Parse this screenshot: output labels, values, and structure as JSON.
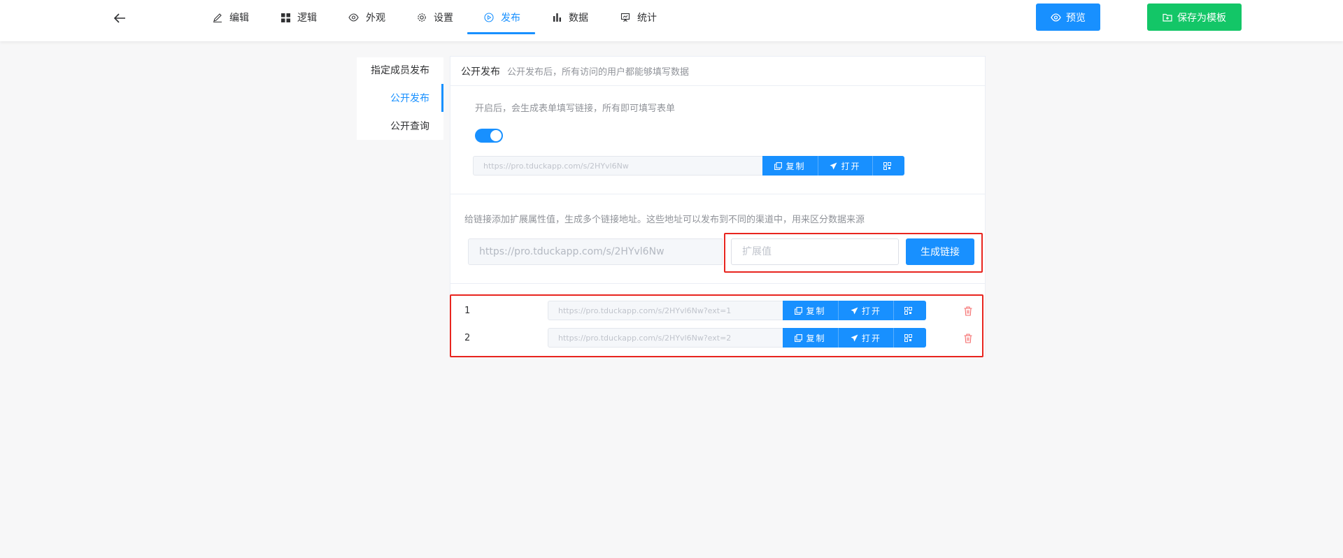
{
  "header": {
    "tabs": [
      {
        "label": "编辑",
        "icon": "edit-icon"
      },
      {
        "label": "逻辑",
        "icon": "logic-icon"
      },
      {
        "label": "外观",
        "icon": "eye-icon"
      },
      {
        "label": "设置",
        "icon": "gear-icon"
      },
      {
        "label": "发布",
        "icon": "play-circle-icon",
        "active": true
      },
      {
        "label": "数据",
        "icon": "bar-chart-icon"
      },
      {
        "label": "统计",
        "icon": "stats-board-icon"
      }
    ],
    "preview_label": "预览",
    "save_template_label": "保存为模板"
  },
  "side_menu": {
    "items": [
      {
        "label": "指定成员发布"
      },
      {
        "label": "公开发布",
        "active": true
      },
      {
        "label": "公开查询"
      }
    ]
  },
  "panel": {
    "title": "公开发布",
    "subtitle": "公开发布后，所有访问的用户都能够填写数据",
    "toggle_hint": "开启后，会生成表单填写链接，所有即可填写表单",
    "toggle_on": true,
    "main_url": "https://pro.tduckapp.com/s/2HYvl6Nw",
    "copy_label": "复制",
    "open_label": "打开",
    "ext_hint": "给链接添加扩展属性值，生成多个链接地址。这些地址可以发布到不同的渠道中，用来区分数据来源",
    "base_url": "https://pro.tduckapp.com/s/2HYvl6Nw",
    "ext_placeholder": "扩展值",
    "generate_label": "生成链接",
    "links": [
      {
        "index": "1",
        "url": "https://pro.tduckapp.com/s/2HYvl6Nw?ext=1"
      },
      {
        "index": "2",
        "url": "https://pro.tduckapp.com/s/2HYvl6Nw?ext=2"
      }
    ]
  },
  "colors": {
    "primary": "#1890ff",
    "success": "#13c667",
    "highlight": "#e8251f",
    "danger": "#f56c6c"
  }
}
